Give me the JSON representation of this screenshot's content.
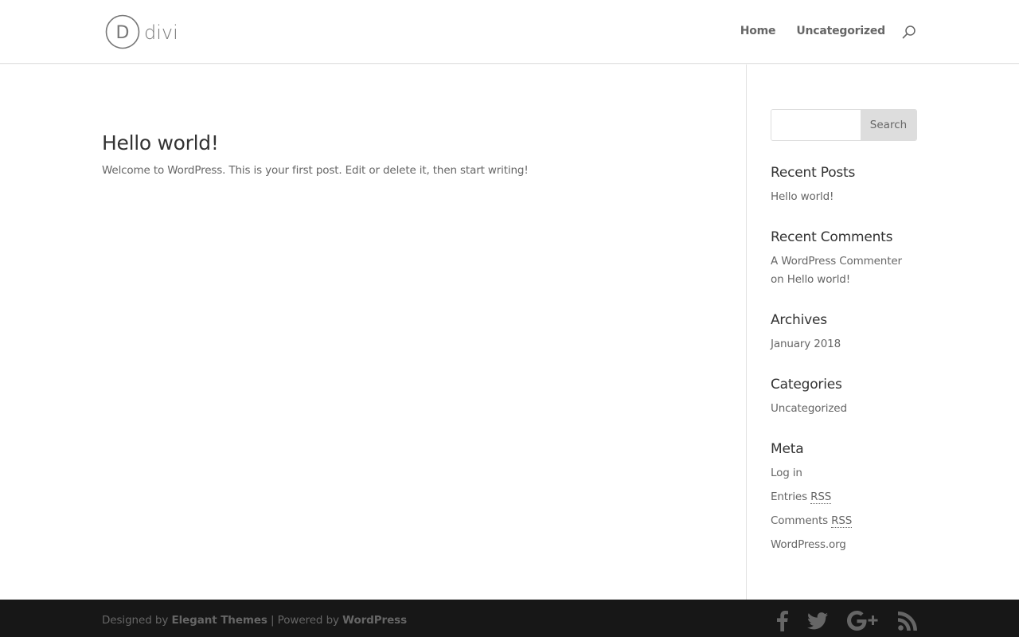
{
  "header": {
    "logo_text": "divi",
    "logo_letter": "D",
    "nav": [
      {
        "label": "Home"
      },
      {
        "label": "Uncategorized"
      }
    ],
    "search_icon": "search-icon"
  },
  "post": {
    "title": "Hello world!",
    "excerpt": "Welcome to WordPress. This is your first post. Edit or delete it, then start writing!"
  },
  "sidebar": {
    "search": {
      "placeholder": "",
      "value": "",
      "button_label": "Search"
    },
    "recent_posts": {
      "title": "Recent Posts",
      "items": [
        "Hello world!"
      ]
    },
    "recent_comments": {
      "title": "Recent Comments",
      "author": "A WordPress Commenter",
      "connector": "on",
      "post": "Hello world!"
    },
    "archives": {
      "title": "Archives",
      "items": [
        "January 2018"
      ]
    },
    "categories": {
      "title": "Categories",
      "items": [
        "Uncategorized"
      ]
    },
    "meta": {
      "title": "Meta",
      "login": "Log in",
      "entries": "Entries",
      "comments": "Comments",
      "rss": "RSS",
      "wordpress_org": "WordPress.org"
    }
  },
  "footer": {
    "designed_by": "Designed by",
    "elegant_themes": "Elegant Themes",
    "separator": "| Powered by",
    "wordpress": "WordPress",
    "social": [
      "facebook-icon",
      "twitter-icon",
      "google-plus-icon",
      "rss-icon"
    ]
  },
  "colors": {
    "text": "#666666",
    "heading": "#333333",
    "footer_bg": "#171717",
    "search_button_bg": "#dddddd",
    "divider": "#e2e2e2"
  }
}
